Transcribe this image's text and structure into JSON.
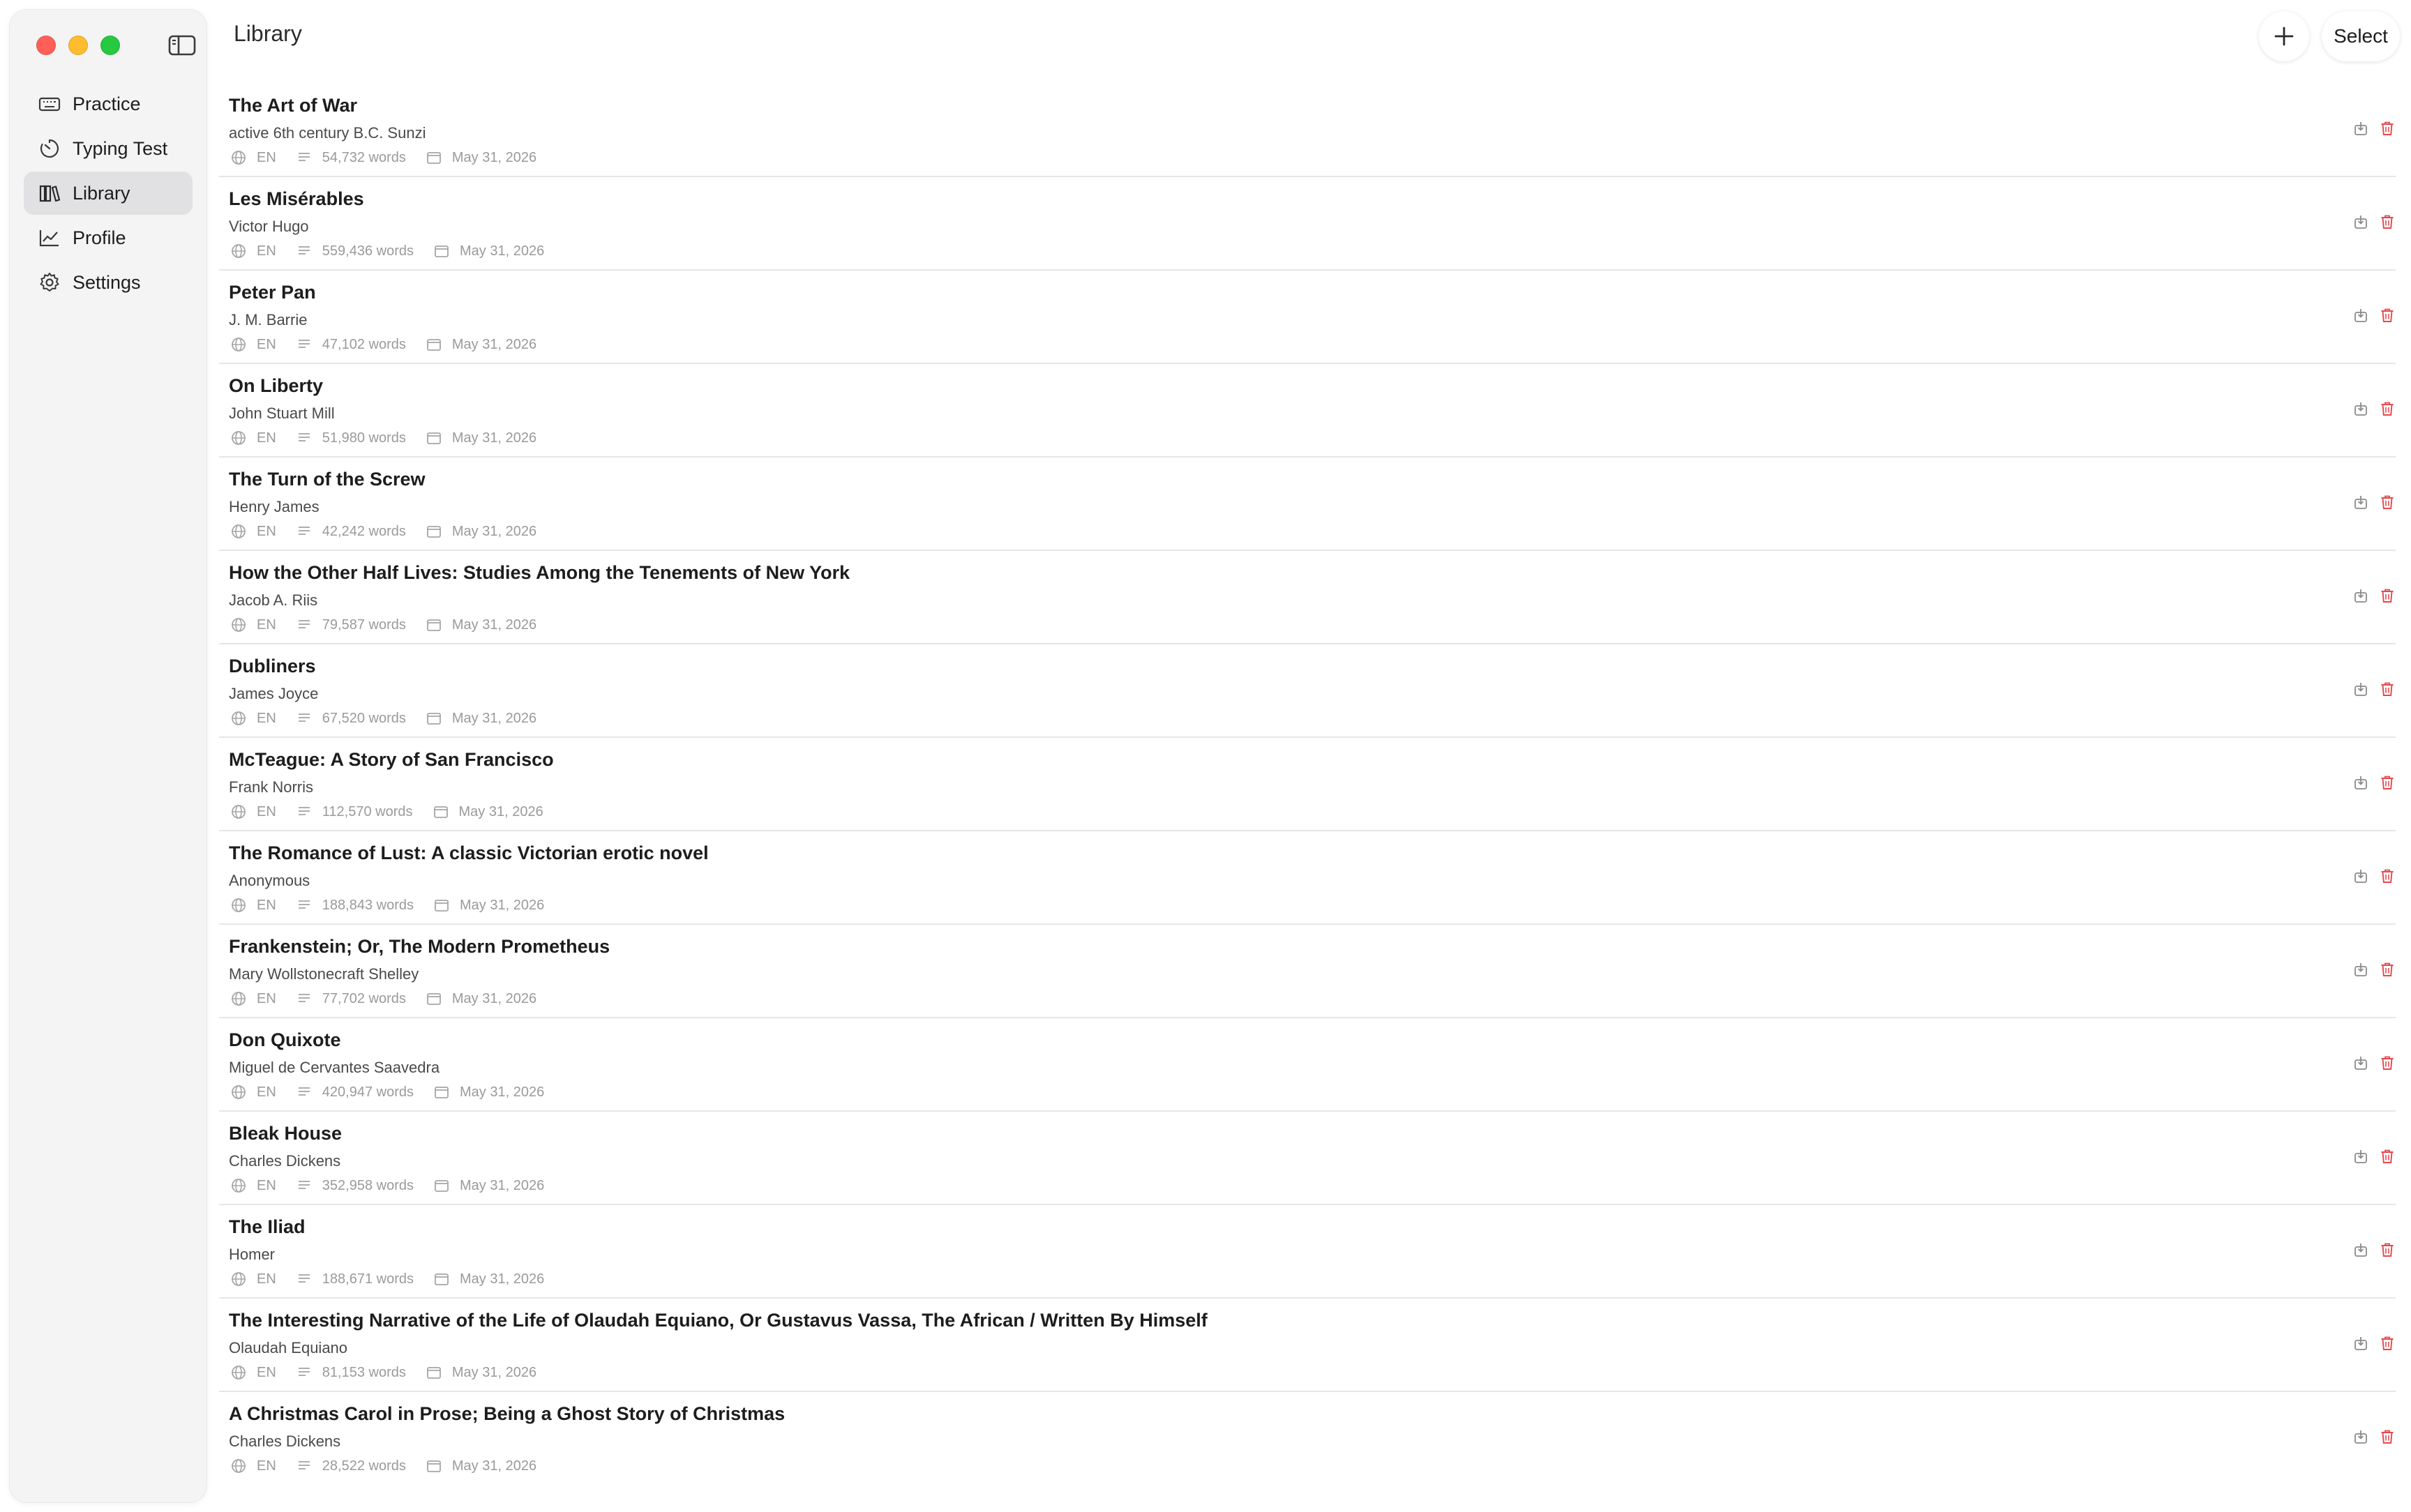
{
  "window": {
    "title": "Library"
  },
  "sidebar": {
    "items": [
      {
        "label": "Practice",
        "icon": "keyboard-icon",
        "active": false
      },
      {
        "label": "Typing Test",
        "icon": "timer-icon",
        "active": false
      },
      {
        "label": "Library",
        "icon": "books-icon",
        "active": true
      },
      {
        "label": "Profile",
        "icon": "chart-line-icon",
        "active": false
      },
      {
        "label": "Settings",
        "icon": "gear-icon",
        "active": false
      }
    ]
  },
  "header": {
    "title": "Library",
    "add_icon": "plus-icon",
    "select_label": "Select"
  },
  "books": [
    {
      "title": "The Art of War",
      "author": "active 6th century B.C. Sunzi",
      "lang": "EN",
      "words": "54,732 words",
      "date": "May 31, 2026"
    },
    {
      "title": "Les Misérables",
      "author": "Victor Hugo",
      "lang": "EN",
      "words": "559,436 words",
      "date": "May 31, 2026"
    },
    {
      "title": "Peter Pan",
      "author": "J. M. Barrie",
      "lang": "EN",
      "words": "47,102 words",
      "date": "May 31, 2026"
    },
    {
      "title": "On Liberty",
      "author": "John Stuart Mill",
      "lang": "EN",
      "words": "51,980 words",
      "date": "May 31, 2026"
    },
    {
      "title": "The Turn of the Screw",
      "author": "Henry James",
      "lang": "EN",
      "words": "42,242 words",
      "date": "May 31, 2026"
    },
    {
      "title": "How the Other Half Lives: Studies Among the Tenements of New York",
      "author": "Jacob A. Riis",
      "lang": "EN",
      "words": "79,587 words",
      "date": "May 31, 2026"
    },
    {
      "title": "Dubliners",
      "author": "James Joyce",
      "lang": "EN",
      "words": "67,520 words",
      "date": "May 31, 2026"
    },
    {
      "title": "McTeague: A Story of San Francisco",
      "author": "Frank Norris",
      "lang": "EN",
      "words": "112,570 words",
      "date": "May 31, 2026"
    },
    {
      "title": "The Romance of Lust: A classic Victorian erotic novel",
      "author": "Anonymous",
      "lang": "EN",
      "words": "188,843 words",
      "date": "May 31, 2026"
    },
    {
      "title": "Frankenstein; Or, The Modern Prometheus",
      "author": "Mary Wollstonecraft Shelley",
      "lang": "EN",
      "words": "77,702 words",
      "date": "May 31, 2026"
    },
    {
      "title": "Don Quixote",
      "author": "Miguel de Cervantes Saavedra",
      "lang": "EN",
      "words": "420,947 words",
      "date": "May 31, 2026"
    },
    {
      "title": "Bleak House",
      "author": "Charles Dickens",
      "lang": "EN",
      "words": "352,958 words",
      "date": "May 31, 2026"
    },
    {
      "title": "The Iliad",
      "author": "Homer",
      "lang": "EN",
      "words": "188,671 words",
      "date": "May 31, 2026"
    },
    {
      "title": "The Interesting Narrative of the Life of Olaudah Equiano, Or Gustavus Vassa, The African / Written By Himself",
      "author": "Olaudah Equiano",
      "lang": "EN",
      "words": "81,153 words",
      "date": "May 31, 2026"
    },
    {
      "title": "A Christmas Carol in Prose; Being a Ghost Story of Christmas",
      "author": "Charles Dickens",
      "lang": "EN",
      "words": "28,522 words",
      "date": "May 31, 2026"
    }
  ],
  "row_icons": {
    "language": "globe-icon",
    "words": "text-lines-icon",
    "date": "calendar-icon",
    "export": "export-icon",
    "delete": "trash-icon"
  },
  "colors": {
    "sidebar_bg": "#f4f4f4",
    "active_item_bg": "#e1e1e3",
    "delete_red": "#e5484d",
    "meta_gray": "#9a9a9a",
    "traffic_red": "#ff5f57",
    "traffic_yellow": "#febc2e",
    "traffic_green": "#28c840"
  }
}
